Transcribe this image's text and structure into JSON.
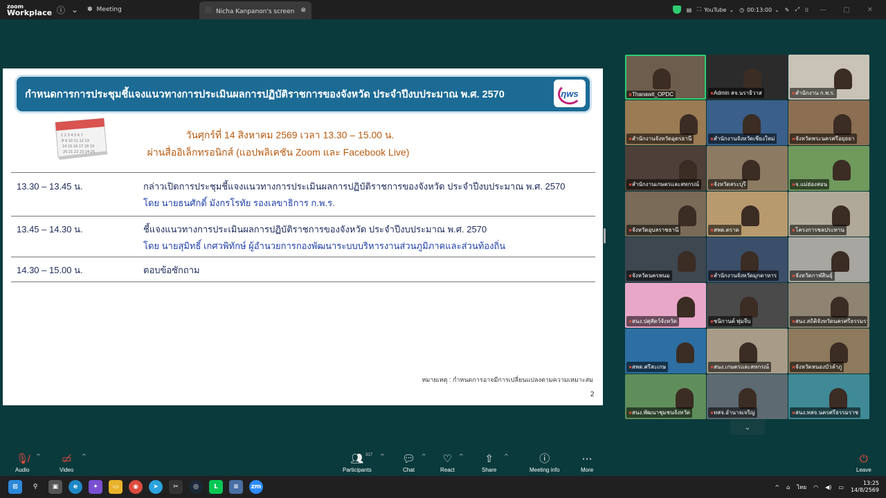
{
  "app": {
    "brand_line1": "zoom",
    "brand_line2": "Workplace"
  },
  "topbar": {
    "meeting_tab": "Meeting",
    "screen_tab": "Nicha Kanpanon's screen",
    "youtube_label": "YouTube",
    "timer": "00:13:00"
  },
  "slide": {
    "title": "กำหนดการการประชุมชี้แจงแนวทางการประเมินผลการปฏิบัติราชการของจังหวัด ประจำปีงบประมาณ พ.ศ. 2570",
    "logo_text": "ηws",
    "date_line": "วันศุกร์ที่ 14 สิงหาคม 2569 เวลา 13.30 – 15.00 น.",
    "channel_line": "ผ่านสื่ออิเล็กทรอนิกส์ (แอปพลิเคชัน Zoom และ Facebook Live)",
    "agenda": [
      {
        "time": "13.30 – 13.45 น.",
        "desc": "กล่าวเปิดการประชุมชี้แจงแนวทางการประเมินผลการปฏิบัติราชการของจังหวัด ประจำปีงบประมาณ พ.ศ. 2570",
        "by": "โดย นายธนศักดิ์  มังกรโรทัย รองเลขาธิการ ก.พ.ร."
      },
      {
        "time": "13.45 – 14.30 น.",
        "desc": "ชี้แจงแนวทางการประเมินผลการปฏิบัติราชการของจังหวัด ประจำปีงบประมาณ พ.ศ. 2570",
        "by": "โดย นายสุมิทธิ์ เกศวพิทักษ์ ผู้อำนวยการกองพัฒนาระบบบริหารงานส่วนภูมิภาคและส่วนท้องถิ่น"
      },
      {
        "time": "14.30 – 15.00 น.",
        "desc": "ตอบข้อซักถาม",
        "by": ""
      }
    ],
    "note": "หมายเหตุ : กำหนดการอาจมีการเปลี่ยนแปลงตามความเหมาะสม",
    "page_number": "2"
  },
  "gallery": {
    "tiles": [
      {
        "name": "Thanawit_OPDC",
        "bg": "#6d5d4c",
        "active": true
      },
      {
        "name": "Admin สจ.นราธิวาส",
        "bg": "#2b2b2b",
        "active": false
      },
      {
        "name": "สำนักงาน ก.พ.ร.",
        "bg": "#c9c3b5",
        "active": false
      },
      {
        "name": "สำนักงานจังหวัดอุดรธานี",
        "bg": "#9a7b54",
        "active": false
      },
      {
        "name": "สำนักงานจังหวัดเชียงใหม่",
        "bg": "#3a5f8a",
        "active": false
      },
      {
        "name": "จังหวัดพระนครศรีอยุธยา",
        "bg": "#8c6e52",
        "active": false
      },
      {
        "name": "สำนักงานเกษตรและสหกรณ์",
        "bg": "#4e4038",
        "active": false
      },
      {
        "name": "จังหวัดสระบุรี",
        "bg": "#8d7a62",
        "active": false
      },
      {
        "name": "จ.แม่ฮ่องสอน",
        "bg": "#6f9a5c",
        "active": false
      },
      {
        "name": "จังหวัดอุบลราชธานี",
        "bg": "#7a6a58",
        "active": false
      },
      {
        "name": "สพด.ตราด",
        "bg": "#b79a6e",
        "active": false
      },
      {
        "name": "โครงการชลประทาน",
        "bg": "#b0a898",
        "active": false
      },
      {
        "name": "จังหวัดนครพนม",
        "bg": "#3e4750",
        "active": false
      },
      {
        "name": "สำนักงานจังหวัดมุกดาหาร",
        "bg": "#3c4f6a",
        "active": false
      },
      {
        "name": "จังหวัดกาฬสินธุ์",
        "bg": "#a7a6a0",
        "active": false
      },
      {
        "name": "สนง.ปศุสัตว์จังหวัด",
        "bg": "#e8a7c9",
        "active": false
      },
      {
        "name": "ชนิกานต์ พุ่มจีบ",
        "bg": "#4a4a4a",
        "active": false
      },
      {
        "name": "สนง.สถิติจังหวัดนครศรีธรรมราช",
        "bg": "#8f8472",
        "active": false
      },
      {
        "name": "สพด.ศรีสะเกษ",
        "bg": "#2d6fa3",
        "active": false
      },
      {
        "name": "สนง.เกษตรและสหกรณ์",
        "bg": "#a89c88",
        "active": false
      },
      {
        "name": "จังหวัดหนองบัวลำภู",
        "bg": "#8e7a5c",
        "active": false
      },
      {
        "name": "สนง.พัฒนาชุมชนจังหวัด",
        "bg": "#5f8e5b",
        "active": false
      },
      {
        "name": "ทสจ.อำนาจเจริญ",
        "bg": "#5d6a72",
        "active": false
      },
      {
        "name": "สนง.ทสจ.นครศรีธรรมราช",
        "bg": "#3f8a96",
        "active": false
      }
    ]
  },
  "toolbar": {
    "audio": "Audio",
    "video": "Video",
    "participants": "Participants",
    "participants_count": "317",
    "chat": "Chat",
    "react": "React",
    "share": "Share",
    "meeting_info": "Meeting info",
    "more": "More",
    "leave": "Leave"
  },
  "taskbar": {
    "lang": "ไทย",
    "time": "13:25",
    "date": "14/8/2569"
  }
}
